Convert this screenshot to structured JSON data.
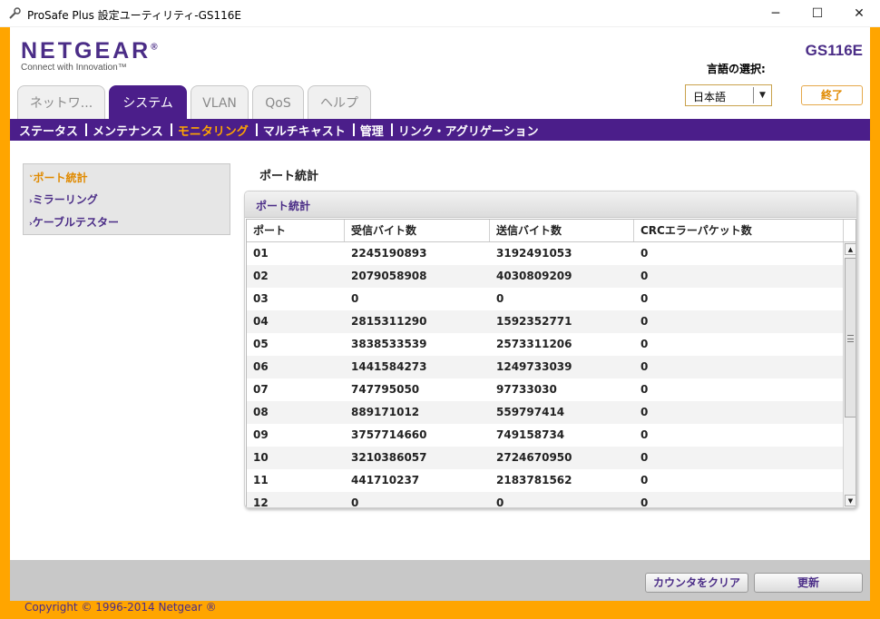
{
  "window": {
    "title": "ProSafe Plus 設定ユーティリティ-GS116E",
    "minimize": "─",
    "maximize": "☐",
    "close": "✕",
    "icon": "wrench-icon"
  },
  "header": {
    "brand": "NETGEAR",
    "registered": "®",
    "tagline": "Connect with Innovation™",
    "model": "GS116E",
    "language_label": "言語の選択:",
    "language_value": "日本語",
    "exit_label": "終了"
  },
  "tabs": [
    {
      "label": "ネットワ..."
    },
    {
      "label": "システム"
    },
    {
      "label": "VLAN"
    },
    {
      "label": "QoS"
    },
    {
      "label": "ヘルプ"
    }
  ],
  "active_tab": "システム",
  "subnav": [
    {
      "label": "ステータス"
    },
    {
      "label": "メンテナンス"
    },
    {
      "label": "モニタリング"
    },
    {
      "label": "マルチキャスト"
    },
    {
      "label": "管理"
    },
    {
      "label": "リンク・アグリゲーション"
    }
  ],
  "active_subnav": "モニタリング",
  "sidebar": {
    "items": [
      {
        "label": "ポート統計",
        "marker": "˅"
      },
      {
        "label": "ミラーリング",
        "marker": "›"
      },
      {
        "label": "ケーブルテスター",
        "marker": "›"
      }
    ]
  },
  "main": {
    "title": "ポート統計",
    "panel_title": "ポート統計",
    "columns": [
      "ポート",
      "受信バイト数",
      "送信バイト数",
      "CRCエラーパケット数"
    ],
    "rows": [
      [
        "01",
        "2245190893",
        "3192491053",
        "0"
      ],
      [
        "02",
        "2079058908",
        "4030809209",
        "0"
      ],
      [
        "03",
        "0",
        "0",
        "0"
      ],
      [
        "04",
        "2815311290",
        "1592352771",
        "0"
      ],
      [
        "05",
        "3838533539",
        "2573311206",
        "0"
      ],
      [
        "06",
        "1441584273",
        "1249733039",
        "0"
      ],
      [
        "07",
        "747795050",
        "97733030",
        "0"
      ],
      [
        "08",
        "889171012",
        "559797414",
        "0"
      ],
      [
        "09",
        "3757714660",
        "749158734",
        "0"
      ],
      [
        "10",
        "3210386057",
        "2724670950",
        "0"
      ],
      [
        "11",
        "441710237",
        "2183781562",
        "0"
      ],
      [
        "12",
        "0",
        "0",
        "0"
      ]
    ]
  },
  "footer": {
    "clear_counters": "カウンタをクリア",
    "refresh": "更新",
    "copyright": "Copyright © 1996-2014 Netgear ®"
  },
  "colors": {
    "purple": "#4b1e8a",
    "orange": "#ffa500"
  }
}
